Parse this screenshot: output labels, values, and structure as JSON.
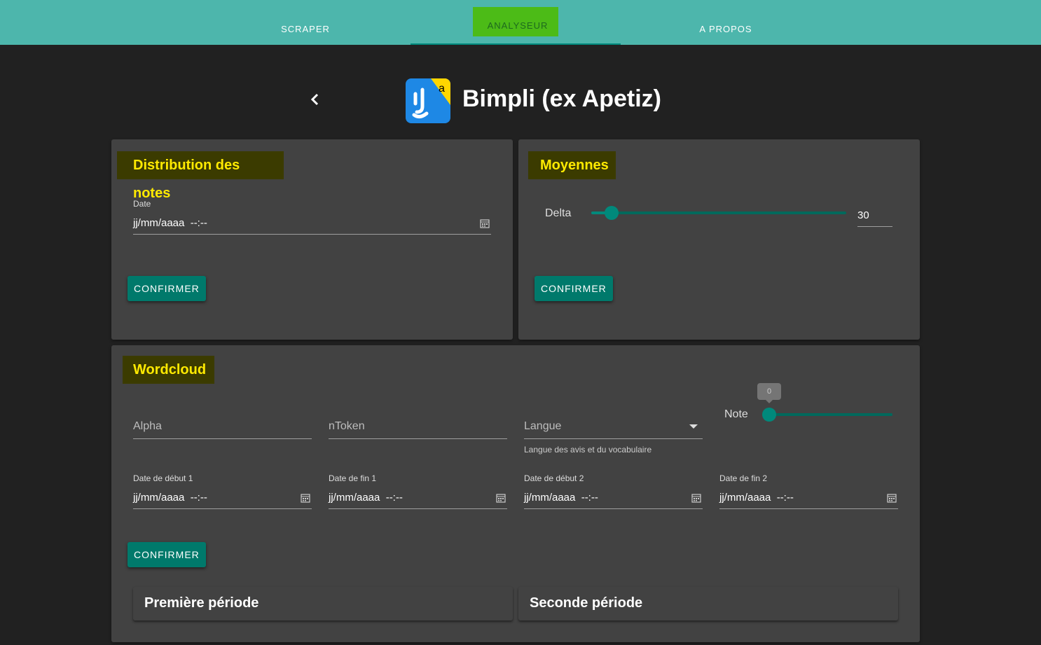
{
  "tabs": [
    {
      "label": "SCRAPER"
    },
    {
      "label": "ANALYSEUR"
    },
    {
      "label": "A PROPOS"
    }
  ],
  "header": {
    "title": "Bimpli (ex Apetiz)",
    "logo_letter": "a"
  },
  "distribution": {
    "title": "Distribution des notes",
    "date_label": "Date",
    "date_value": "jj/mm/aaaa  --:--",
    "confirm": "CONFIRMER"
  },
  "moyennes": {
    "title": "Moyennes",
    "delta_label": "Delta",
    "delta_value": "30",
    "confirm": "CONFIRMER"
  },
  "wordcloud": {
    "title": "Wordcloud",
    "alpha_label": "Alpha",
    "ntoken_label": "nToken",
    "langue_label": "Langue",
    "langue_hint": "Langue des avis et du vocabulaire",
    "note_label": "Note",
    "note_value": "0",
    "dates": [
      {
        "label": "Date de début 1",
        "value": "jj/mm/aaaa  --:--"
      },
      {
        "label": "Date de fin 1",
        "value": "jj/mm/aaaa  --:--"
      },
      {
        "label": "Date de début 2",
        "value": "jj/mm/aaaa  --:--"
      },
      {
        "label": "Date de fin 2",
        "value": "jj/mm/aaaa  --:--"
      }
    ],
    "confirm": "CONFIRMER",
    "period1": "Première période",
    "period2": "Seconde période"
  },
  "colors": {
    "topbar": "#4db6ac",
    "accent": "#00796b",
    "title_highlight": "#ffea00"
  }
}
